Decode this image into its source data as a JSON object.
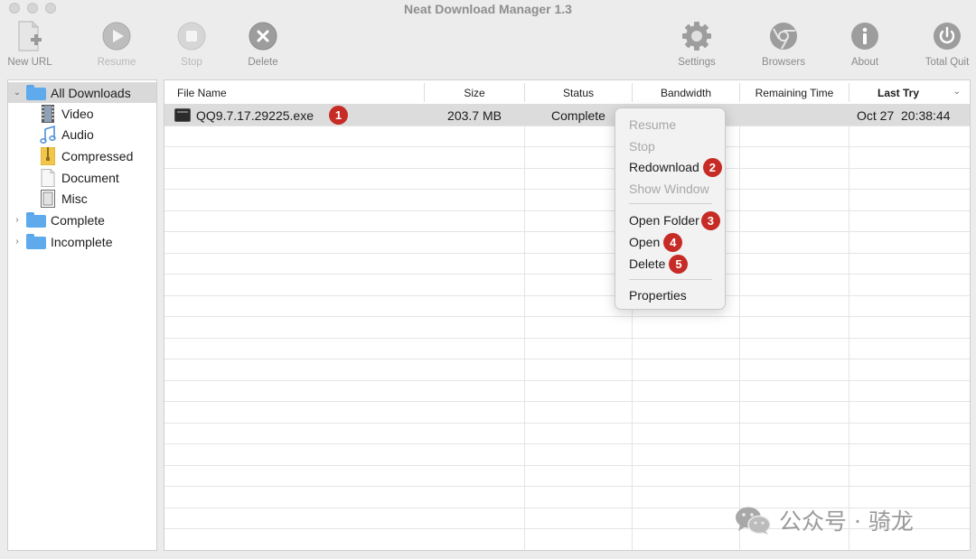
{
  "window": {
    "title": "Neat Download Manager 1.3"
  },
  "toolbar": {
    "left": [
      {
        "id": "new-url",
        "label": "New URL",
        "icon": "new-url-icon",
        "enabled": true
      },
      {
        "id": "resume",
        "label": "Resume",
        "icon": "play-icon",
        "enabled": false
      },
      {
        "id": "stop",
        "label": "Stop",
        "icon": "stop-icon",
        "enabled": false
      },
      {
        "id": "delete",
        "label": "Delete",
        "icon": "delete-icon",
        "enabled": true
      }
    ],
    "right": [
      {
        "id": "settings",
        "label": "Settings",
        "icon": "gear-icon",
        "enabled": true
      },
      {
        "id": "browsers",
        "label": "Browsers",
        "icon": "browser-icon",
        "enabled": true
      },
      {
        "id": "about",
        "label": "About",
        "icon": "info-icon",
        "enabled": true
      },
      {
        "id": "total-quit",
        "label": "Total Quit",
        "icon": "power-icon",
        "enabled": true
      }
    ]
  },
  "sidebar": {
    "all_downloads": "All Downloads",
    "categories": [
      {
        "label": "Video",
        "icon": "film-icon"
      },
      {
        "label": "Audio",
        "icon": "music-note-icon"
      },
      {
        "label": "Compressed",
        "icon": "archive-icon"
      },
      {
        "label": "Document",
        "icon": "document-icon"
      },
      {
        "label": "Misc",
        "icon": "misc-file-icon"
      }
    ],
    "complete": "Complete",
    "incomplete": "Incomplete",
    "disclosure_open": "⌄",
    "disclosure_closed": "›"
  },
  "table": {
    "columns": {
      "file_name": "File Name",
      "size": "Size",
      "status": "Status",
      "bandwidth": "Bandwidth",
      "remaining_time": "Remaining Time",
      "last_try": "Last Try"
    },
    "rows": [
      {
        "file_name": "QQ9.7.17.29225.exe",
        "size": "203.7 MB",
        "status": "Complete",
        "bandwidth": "",
        "remaining_time": "",
        "last_try": "Oct 27  20:38:44"
      }
    ]
  },
  "context_menu": {
    "resume": "Resume",
    "stop": "Stop",
    "redownload": "Redownload",
    "show_window": "Show Window",
    "open_folder": "Open Folder",
    "open": "Open",
    "delete": "Delete",
    "properties": "Properties"
  },
  "annotations": [
    "1",
    "2",
    "3",
    "4",
    "5"
  ],
  "watermark": {
    "text": "公众号 · 骑龙"
  },
  "colors": {
    "badge": "#c62b26",
    "folder": "#5eaaec",
    "selection": "#d9d9d9"
  }
}
